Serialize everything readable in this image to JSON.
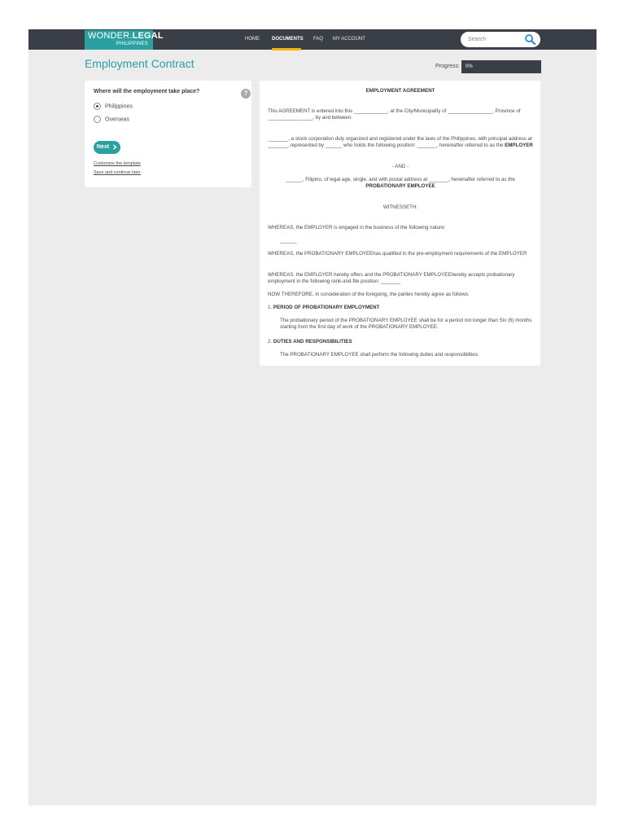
{
  "nav": {
    "logo_main": "WONDER.",
    "logo_bold": "LEGAL",
    "logo_sub": "PHILIPPINES",
    "items": [
      "HOME",
      "DOCUMENTS",
      "FAQ",
      "MY ACCOUNT"
    ],
    "active_index": 1,
    "search_placeholder": "Search"
  },
  "page": {
    "title": "Employment Contract",
    "progress_label": "Progress:",
    "progress_value": "0%",
    "progress_fraction": 0
  },
  "question_panel": {
    "question": "Where will the employment take place?",
    "help": "?",
    "options": [
      {
        "label": "Philippines",
        "selected": true
      },
      {
        "label": "Overseas",
        "selected": false
      }
    ],
    "next_label": "Next",
    "next_icon": "chevron-right-icon",
    "customize_link": "Customize the template",
    "save_link": "Save and continue later"
  },
  "document": {
    "title": "EMPLOYMENT AGREEMENT",
    "intro": "This AGREEMENT is entered into this ____________, at the City/Municipality of ________________, Province of ________________, by and between:",
    "employer": "_______, a stock corporation duly organized and registered under the laws of the Philippines, with principal address at _______, represented by ______ who holds the following position: _______, hereinafter referred to as the",
    "employer_bold": "EMPLOYER",
    "and": "- AND -",
    "employee": "______, Filipino, of legal age, single, and with postal address at _______, hereinafter referred to as the",
    "employee_bold": "PROBATIONARY EMPLOYEE",
    "witnesseth": "WITNESSETH:",
    "whereas1": "WHEREAS, the EMPLOYER is engaged in the business of the following nature:",
    "blank1": "______",
    "whereas2": "WHEREAS, the PROBATIONARY EMPLOYEEhas qualified in the pre-employment requirements of the EMPLOYER",
    "whereas3": "WHEREAS, the EMPLOYER hereby offers and the PROBATIONARY EMPLOYEEhereby accepts probationary employment in the following rank-and-file position: _______",
    "now": "NOW THEREFORE, in consideration of the foregoing, the parties hereby agree as follows:",
    "s1_num": "1.",
    "s1_title": "PERIOD OF PROBATIONARY EMPLOYMENT",
    "s1_text": "The probationary period of the PROBATIONARY EMPLOYEE shall be for a period not longer than Six (6) months starting from the first day of work of the PROBATIONARY EMPLOYEE.",
    "s2_num": "2.",
    "s2_title": "DUTIES AND RESPONSIBILITIES",
    "s2_text": "The PROBATIONARY EMPLOYEE shall perform the following duties and responsibilities:"
  }
}
